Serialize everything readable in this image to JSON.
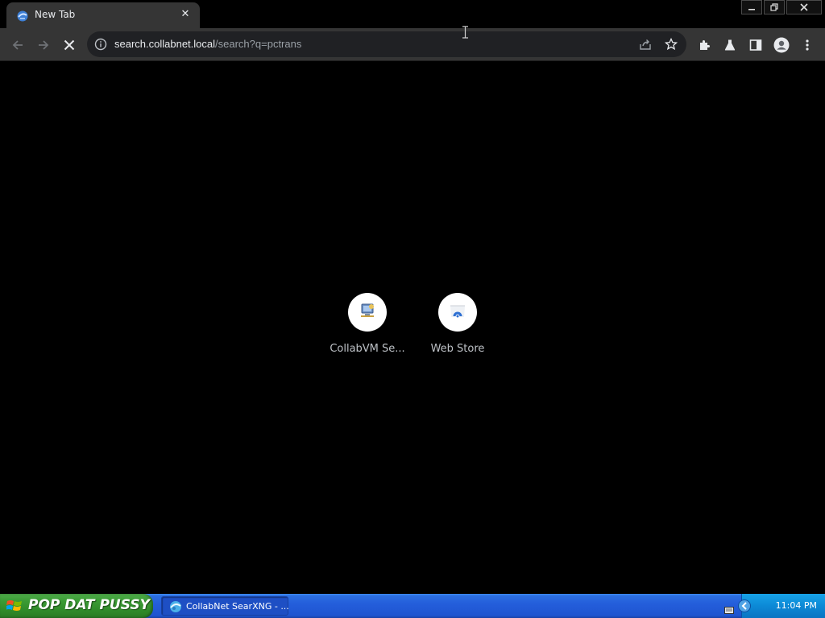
{
  "tab": {
    "title": "New Tab",
    "close_glyph": "✕",
    "favicon": "collabvm-icon"
  },
  "window_controls": {
    "minimize": "minimize-icon",
    "restore": "restore-icon",
    "close": "close-icon"
  },
  "toolbar": {
    "back": "back-arrow-icon",
    "forward": "forward-arrow-icon",
    "stop": "stop-loading-icon",
    "url_host": "search.collabnet.local",
    "url_path": "/search?q=pctrans",
    "icons": [
      "share-icon",
      "bookmark-star-icon",
      "extensions-icon",
      "labs-icon",
      "side-panel-icon",
      "profile-icon",
      "menu-icon"
    ]
  },
  "shortcuts": [
    {
      "label": "CollabVM Se...",
      "icon": "collabvm-icon"
    },
    {
      "label": "Web Store",
      "icon": "web-store-icon"
    }
  ],
  "taskbar": {
    "start_label": "POP DAT PUSSY",
    "task_label": "CollabNet SearXNG - ...",
    "clock": "11:04 PM"
  },
  "colors": {
    "tabstrip": "#000000",
    "toolbar": "#353535",
    "omnibox": "#202124",
    "content_bg": "#000000",
    "taskbar_blue": "#245edb",
    "start_green": "#3b9b35"
  }
}
